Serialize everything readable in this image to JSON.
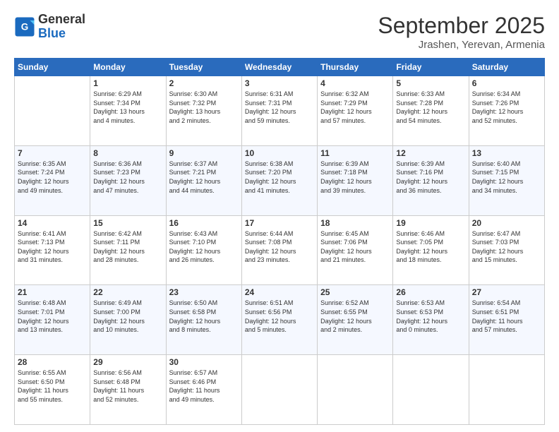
{
  "logo": {
    "line1": "General",
    "line2": "Blue"
  },
  "header": {
    "month": "September 2025",
    "location": "Jrashen, Yerevan, Armenia"
  },
  "weekdays": [
    "Sunday",
    "Monday",
    "Tuesday",
    "Wednesday",
    "Thursday",
    "Friday",
    "Saturday"
  ],
  "weeks": [
    [
      {
        "day": "",
        "info": ""
      },
      {
        "day": "1",
        "info": "Sunrise: 6:29 AM\nSunset: 7:34 PM\nDaylight: 13 hours\nand 4 minutes."
      },
      {
        "day": "2",
        "info": "Sunrise: 6:30 AM\nSunset: 7:32 PM\nDaylight: 13 hours\nand 2 minutes."
      },
      {
        "day": "3",
        "info": "Sunrise: 6:31 AM\nSunset: 7:31 PM\nDaylight: 12 hours\nand 59 minutes."
      },
      {
        "day": "4",
        "info": "Sunrise: 6:32 AM\nSunset: 7:29 PM\nDaylight: 12 hours\nand 57 minutes."
      },
      {
        "day": "5",
        "info": "Sunrise: 6:33 AM\nSunset: 7:28 PM\nDaylight: 12 hours\nand 54 minutes."
      },
      {
        "day": "6",
        "info": "Sunrise: 6:34 AM\nSunset: 7:26 PM\nDaylight: 12 hours\nand 52 minutes."
      }
    ],
    [
      {
        "day": "7",
        "info": "Sunrise: 6:35 AM\nSunset: 7:24 PM\nDaylight: 12 hours\nand 49 minutes."
      },
      {
        "day": "8",
        "info": "Sunrise: 6:36 AM\nSunset: 7:23 PM\nDaylight: 12 hours\nand 47 minutes."
      },
      {
        "day": "9",
        "info": "Sunrise: 6:37 AM\nSunset: 7:21 PM\nDaylight: 12 hours\nand 44 minutes."
      },
      {
        "day": "10",
        "info": "Sunrise: 6:38 AM\nSunset: 7:20 PM\nDaylight: 12 hours\nand 41 minutes."
      },
      {
        "day": "11",
        "info": "Sunrise: 6:39 AM\nSunset: 7:18 PM\nDaylight: 12 hours\nand 39 minutes."
      },
      {
        "day": "12",
        "info": "Sunrise: 6:39 AM\nSunset: 7:16 PM\nDaylight: 12 hours\nand 36 minutes."
      },
      {
        "day": "13",
        "info": "Sunrise: 6:40 AM\nSunset: 7:15 PM\nDaylight: 12 hours\nand 34 minutes."
      }
    ],
    [
      {
        "day": "14",
        "info": "Sunrise: 6:41 AM\nSunset: 7:13 PM\nDaylight: 12 hours\nand 31 minutes."
      },
      {
        "day": "15",
        "info": "Sunrise: 6:42 AM\nSunset: 7:11 PM\nDaylight: 12 hours\nand 28 minutes."
      },
      {
        "day": "16",
        "info": "Sunrise: 6:43 AM\nSunset: 7:10 PM\nDaylight: 12 hours\nand 26 minutes."
      },
      {
        "day": "17",
        "info": "Sunrise: 6:44 AM\nSunset: 7:08 PM\nDaylight: 12 hours\nand 23 minutes."
      },
      {
        "day": "18",
        "info": "Sunrise: 6:45 AM\nSunset: 7:06 PM\nDaylight: 12 hours\nand 21 minutes."
      },
      {
        "day": "19",
        "info": "Sunrise: 6:46 AM\nSunset: 7:05 PM\nDaylight: 12 hours\nand 18 minutes."
      },
      {
        "day": "20",
        "info": "Sunrise: 6:47 AM\nSunset: 7:03 PM\nDaylight: 12 hours\nand 15 minutes."
      }
    ],
    [
      {
        "day": "21",
        "info": "Sunrise: 6:48 AM\nSunset: 7:01 PM\nDaylight: 12 hours\nand 13 minutes."
      },
      {
        "day": "22",
        "info": "Sunrise: 6:49 AM\nSunset: 7:00 PM\nDaylight: 12 hours\nand 10 minutes."
      },
      {
        "day": "23",
        "info": "Sunrise: 6:50 AM\nSunset: 6:58 PM\nDaylight: 12 hours\nand 8 minutes."
      },
      {
        "day": "24",
        "info": "Sunrise: 6:51 AM\nSunset: 6:56 PM\nDaylight: 12 hours\nand 5 minutes."
      },
      {
        "day": "25",
        "info": "Sunrise: 6:52 AM\nSunset: 6:55 PM\nDaylight: 12 hours\nand 2 minutes."
      },
      {
        "day": "26",
        "info": "Sunrise: 6:53 AM\nSunset: 6:53 PM\nDaylight: 12 hours\nand 0 minutes."
      },
      {
        "day": "27",
        "info": "Sunrise: 6:54 AM\nSunset: 6:51 PM\nDaylight: 11 hours\nand 57 minutes."
      }
    ],
    [
      {
        "day": "28",
        "info": "Sunrise: 6:55 AM\nSunset: 6:50 PM\nDaylight: 11 hours\nand 55 minutes."
      },
      {
        "day": "29",
        "info": "Sunrise: 6:56 AM\nSunset: 6:48 PM\nDaylight: 11 hours\nand 52 minutes."
      },
      {
        "day": "30",
        "info": "Sunrise: 6:57 AM\nSunset: 6:46 PM\nDaylight: 11 hours\nand 49 minutes."
      },
      {
        "day": "",
        "info": ""
      },
      {
        "day": "",
        "info": ""
      },
      {
        "day": "",
        "info": ""
      },
      {
        "day": "",
        "info": ""
      }
    ]
  ]
}
